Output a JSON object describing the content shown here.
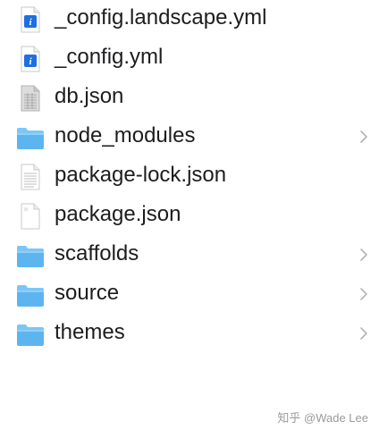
{
  "files": [
    {
      "name": "_config.landscape.yml",
      "icon": "yaml-file-icon",
      "has_children": false
    },
    {
      "name": "_config.yml",
      "icon": "yaml-file-icon",
      "has_children": false
    },
    {
      "name": "db.json",
      "icon": "json-data-file-icon",
      "has_children": false
    },
    {
      "name": "node_modules",
      "icon": "folder-icon",
      "has_children": true
    },
    {
      "name": "package-lock.json",
      "icon": "text-file-icon",
      "has_children": false
    },
    {
      "name": "package.json",
      "icon": "blank-file-icon",
      "has_children": false
    },
    {
      "name": "scaffolds",
      "icon": "folder-icon",
      "has_children": true
    },
    {
      "name": "source",
      "icon": "folder-icon",
      "has_children": true
    },
    {
      "name": "themes",
      "icon": "folder-icon",
      "has_children": true
    }
  ],
  "watermark": "知乎 @Wade Lee",
  "colors": {
    "folder": "#5db5ef",
    "folder_tab": "#7cc6f7",
    "yaml_badge": "#1e6fe0",
    "text": "#1d1d1f",
    "chevron": "#b5b5b5"
  }
}
